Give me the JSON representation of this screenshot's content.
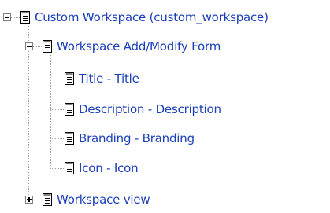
{
  "colors": {
    "link": "#1a3fb8",
    "line": "#a0a0a0"
  },
  "tree": {
    "root": {
      "label": "Custom Workspace (custom_workspace)",
      "toggle": "collapse",
      "icon": "document-icon"
    },
    "form": {
      "label": "Workspace Add/Modify Form",
      "toggle": "collapse",
      "icon": "document-icon",
      "children": [
        {
          "label": "Title - Title",
          "icon": "document-icon"
        },
        {
          "label": "Description - Description",
          "icon": "document-icon"
        },
        {
          "label": "Branding - Branding",
          "icon": "document-icon"
        },
        {
          "label": "Icon - Icon",
          "icon": "document-icon"
        }
      ]
    },
    "view": {
      "label": "Workspace view",
      "toggle": "expand",
      "icon": "document-icon"
    }
  }
}
